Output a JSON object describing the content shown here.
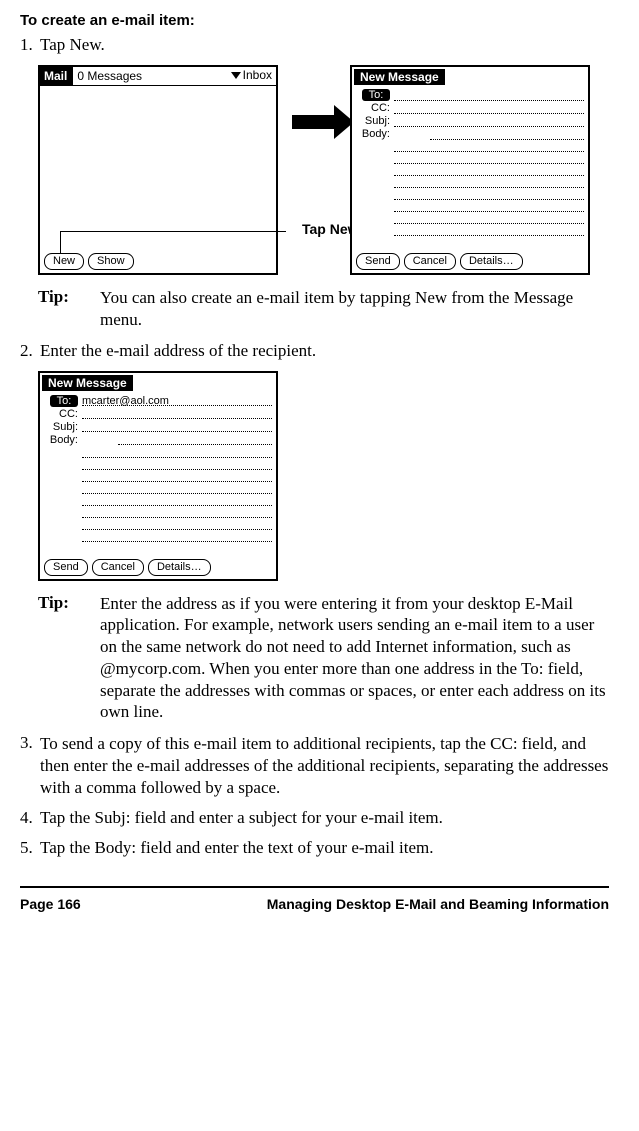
{
  "heading": "To create an e-mail item:",
  "steps": {
    "s1_num": "1.",
    "s1_txt": "Tap New.",
    "s2_num": "2.",
    "s2_txt": "Enter the e-mail address of the recipient.",
    "s3_num": "3.",
    "s3_txt": "To send a copy of this e-mail item to additional recipients, tap the CC: field, and then enter the e-mail addresses of the additional recipients, separating the addresses with a comma followed by a space.",
    "s4_num": "4.",
    "s4_txt": "Tap the Subj: field and enter a subject for your e-mail item.",
    "s5_num": "5.",
    "s5_txt": "Tap the Body: field and enter the text of your e-mail item."
  },
  "tips": {
    "label": "Tip:",
    "t1": "You can also create an e-mail item by tapping New from the Message menu.",
    "t2": "Enter the address as if you were entering it from your desktop E-Mail application. For example, network users sending an e-mail item to a user on the same network do not need to add Internet information, such as @mycorp.com. When you enter more than one address in the To: field, separate the addresses with commas or spaces, or enter each address on its own line."
  },
  "device_inbox": {
    "app": "Mail",
    "count": "0 Messages",
    "folder": "Inbox",
    "btn_new": "New",
    "btn_show": "Show"
  },
  "device_newmsg": {
    "title": "New Message",
    "to_label": "To:",
    "cc_label": "CC:",
    "subj_label": "Subj:",
    "body_label": "Body:",
    "to_value_example": "mcarter@aol.com",
    "btn_send": "Send",
    "btn_cancel": "Cancel",
    "btn_details": "Details…"
  },
  "annotations": {
    "tap_new": "Tap New"
  },
  "footer": {
    "page": "Page 166",
    "chapter": "Managing Desktop E-Mail and Beaming Information"
  }
}
